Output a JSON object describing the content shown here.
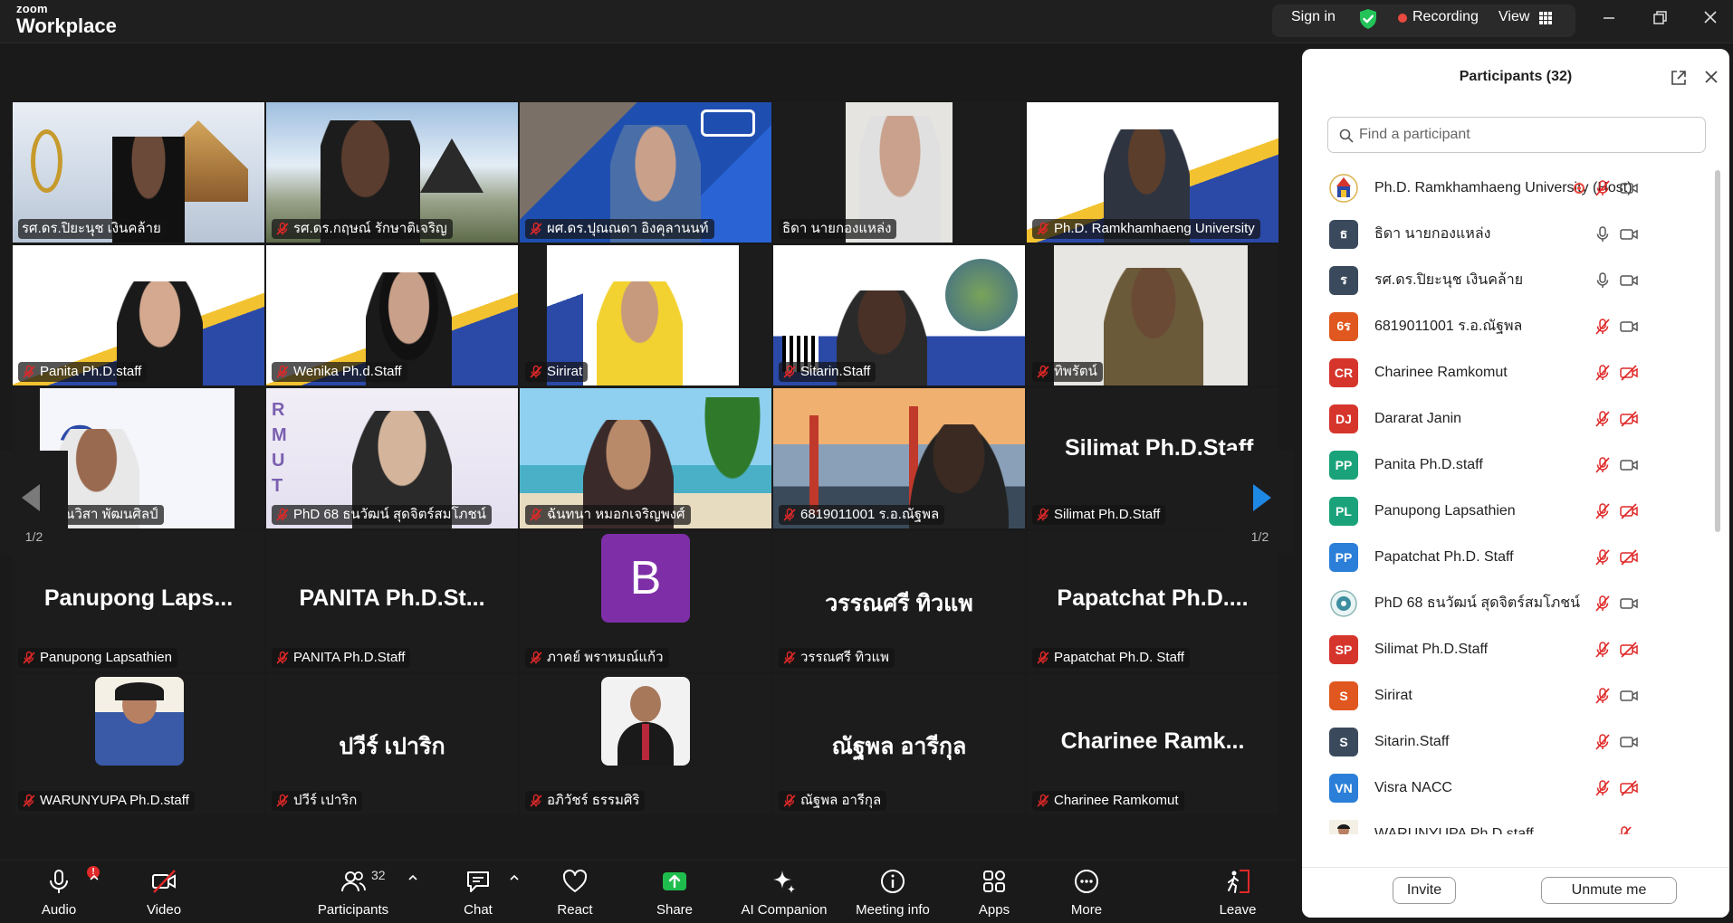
{
  "titlebar": {
    "logo_line1": "zoom",
    "logo_line2": "Workplace",
    "signin": "Sign in",
    "recording": "Recording",
    "view": "View"
  },
  "colors": {
    "active_speaker": "#23d97d",
    "recording": "#e84a3f",
    "share_green": "#1fbd4d",
    "muted_red": "#e02828",
    "nav_arrow_blue": "#1e88e5"
  },
  "gallery": {
    "page_indicator_left": "1/2",
    "page_indicator_right": "1/2",
    "tiles": [
      {
        "name": "รศ.ดร.ปิยะนุช เงินคล้าย",
        "muted": false,
        "active": true
      },
      {
        "name": "รศ.ดร.กฤษณ์ รักษาติเจริญ",
        "muted": true
      },
      {
        "name": "ผศ.ดร.ปุณณดา อิงคุลานนท์",
        "muted": true
      },
      {
        "name": "ธิดา นายกองแหล่ง",
        "muted": false
      },
      {
        "name": "Ph.D. Ramkhamhaeng University",
        "muted": true
      },
      {
        "name": "Panita Ph.D.staff",
        "muted": true
      },
      {
        "name": "Wenika Ph.d.Staff",
        "muted": true
      },
      {
        "name": "Sirirat",
        "muted": true
      },
      {
        "name": "Sitarin.Staff",
        "muted": true
      },
      {
        "name": "ทิพรัตน์",
        "muted": true
      },
      {
        "name": "วรรณวิสา พัฒนศิลป์",
        "muted": true
      },
      {
        "name": "PhD 68 ธนวัฒน์ สุดจิตร์สมโภชน์",
        "muted": true
      },
      {
        "name": "ฉันทนา หมอกเจริญพงศ์",
        "muted": true
      },
      {
        "name": "6819011001 ร.อ.ณัฐพล",
        "muted": true
      },
      {
        "name": "Silimat Ph.D.Staff",
        "muted": true,
        "big": "Silimat Ph.D.Staff"
      },
      {
        "name": "Panupong Lapsathien",
        "muted": true,
        "big": "Panupong Laps..."
      },
      {
        "name": "PANITA Ph.D.Staff",
        "muted": true,
        "big": "PANITA Ph.D.St..."
      },
      {
        "name": "ภาคย์ พราหมณ์แก้ว",
        "muted": true,
        "initial": "B"
      },
      {
        "name": "วรรณศรี ทิวแพ",
        "muted": true,
        "big": "วรรณศรี ทิวแพ"
      },
      {
        "name": "Papatchat Ph.D. Staff",
        "muted": true,
        "big": "Papatchat Ph.D...."
      },
      {
        "name": "WARUNYUPA Ph.D.staff",
        "muted": true
      },
      {
        "name": "ปวีร์ เปาริก",
        "muted": true,
        "big": "ปวีร์ เปาริก"
      },
      {
        "name": "อภิวัชร์ ธรรมศิริ",
        "muted": true
      },
      {
        "name": "ณัฐพล อารีกุล",
        "muted": true,
        "big": "ณัฐพล อารีกุล"
      },
      {
        "name": "Charinee Ramkomut",
        "muted": true,
        "big": "Charinee Ramk..."
      }
    ]
  },
  "panel": {
    "title": "Participants (32)",
    "search_placeholder": "Find a participant",
    "invite": "Invite",
    "unmute": "Unmute me",
    "participants": [
      {
        "initials": "",
        "color": "#ffffff",
        "name": "Ph.D. Ramkhamhaeng University (Host)",
        "mic": "muted",
        "cam": "on",
        "recording": true,
        "avatar": "logo"
      },
      {
        "initials": "ธ",
        "color": "#3a4a5c",
        "name": "ธิดา นายกองแหล่ง",
        "mic": "on",
        "cam": "on"
      },
      {
        "initials": "ร",
        "color": "#3a4a5c",
        "name": "รศ.ดร.ปิยะนุช เงินคล้าย",
        "mic": "on",
        "cam": "on"
      },
      {
        "initials": "6ร",
        "color": "#e0581f",
        "name": "6819011001 ร.อ.ณัฐพล",
        "mic": "muted",
        "cam": "on"
      },
      {
        "initials": "CR",
        "color": "#d6352c",
        "name": "Charinee Ramkomut",
        "mic": "muted",
        "cam": "off"
      },
      {
        "initials": "DJ",
        "color": "#d6352c",
        "name": "Dararat Janin",
        "mic": "muted",
        "cam": "off"
      },
      {
        "initials": "PP",
        "color": "#1aa37a",
        "name": "Panita Ph.D.staff",
        "mic": "muted",
        "cam": "on"
      },
      {
        "initials": "PL",
        "color": "#1aa37a",
        "name": "Panupong Lapsathien",
        "mic": "muted",
        "cam": "off"
      },
      {
        "initials": "PP",
        "color": "#2b7fd8",
        "name": "Papatchat Ph.D. Staff",
        "mic": "muted",
        "cam": "off"
      },
      {
        "initials": "",
        "color": "#ffffff",
        "name": "PhD 68 ธนวัฒน์ สุดจิตร์สมโภชน์",
        "mic": "muted",
        "cam": "on",
        "avatar": "globe"
      },
      {
        "initials": "SP",
        "color": "#d6352c",
        "name": "Silimat Ph.D.Staff",
        "mic": "muted",
        "cam": "off"
      },
      {
        "initials": "S",
        "color": "#e0581f",
        "name": "Sirirat",
        "mic": "muted",
        "cam": "on"
      },
      {
        "initials": "S",
        "color": "#3a4a5c",
        "name": "Sitarin.Staff",
        "mic": "muted",
        "cam": "on"
      },
      {
        "initials": "VN",
        "color": "#2b7fd8",
        "name": "Visra NACC",
        "mic": "muted",
        "cam": "off"
      },
      {
        "initials": "",
        "color": "#ffffff",
        "name": "WARUNYUPA Ph.D.staff",
        "mic": "muted",
        "cam": "none",
        "avatar": "photo"
      }
    ]
  },
  "toolbar": {
    "audio": "Audio",
    "audio_badge": "!",
    "video": "Video",
    "participants": "Participants",
    "participants_count": "32",
    "chat": "Chat",
    "react": "React",
    "share": "Share",
    "ai": "AI Companion",
    "meeting_info": "Meeting info",
    "apps": "Apps",
    "more": "More",
    "leave": "Leave"
  }
}
